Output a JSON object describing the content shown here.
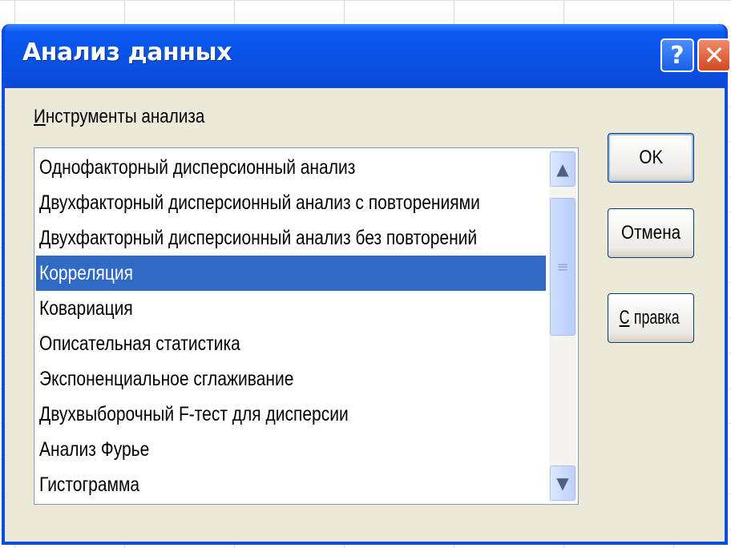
{
  "window": {
    "title": "Анализ данных",
    "help_glyph": "?",
    "close_glyph": "✕"
  },
  "tools": {
    "label_accel": "И",
    "label_rest": "нструменты анализа",
    "items": [
      "Однофакторный дисперсионный анализ",
      "Двухфакторный дисперсионный анализ с повторениями",
      "Двухфакторный дисперсионный анализ без повторений",
      "Корреляция",
      "Ковариация",
      "Описательная статистика",
      "Экспоненциальное сглаживание",
      "Двухвыборочный F-тест для дисперсии",
      "Анализ Фурье",
      "Гистограмма"
    ],
    "selected_index": 3
  },
  "buttons": {
    "ok": "OK",
    "cancel": "Отмена",
    "help_accel": "С",
    "help_rest": "правка"
  },
  "scrollbar": {
    "up_glyph": "▲",
    "down_glyph": "▼",
    "thumb_glyph": "≡"
  },
  "colors": {
    "titlebar": "#0a52e6",
    "selection": "#316ac5",
    "dialog_bg": "#ece9d8"
  }
}
